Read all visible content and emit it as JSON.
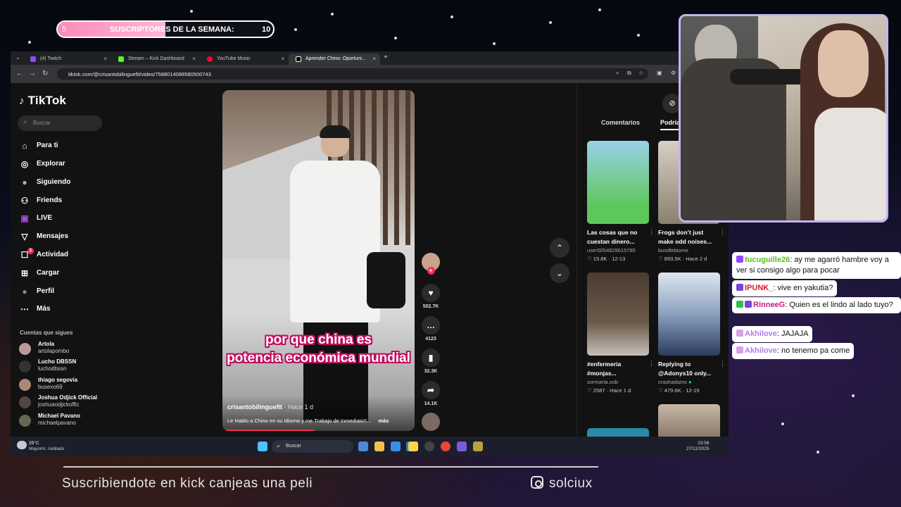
{
  "overlay": {
    "sub_goal": {
      "current": "5",
      "label": "SUSCRIPTORES DE LA SEMANA:",
      "goal": "10",
      "progress": 0.5
    },
    "promo_text": "Suscribiendote en kick canjeas una peli",
    "social_handle": "solciux"
  },
  "browser": {
    "tabs": [
      {
        "label": "(4) Twitch",
        "color": "#9146ff"
      },
      {
        "label": "Stream – Kick Dashboard",
        "color": "#53fc18"
      },
      {
        "label": "YouTube Music",
        "color": "#ff0033"
      },
      {
        "label": "Aprender Chino: Oportuni...",
        "color": "#ffffff"
      }
    ],
    "new_tab": "+",
    "url": "tiktok.com/@crisantobilinguefit/video/7588014088580500743"
  },
  "tiktok": {
    "logo": "TikTok",
    "search_placeholder": "Buscar",
    "nav": [
      {
        "label": "Para ti",
        "icon": "⌂"
      },
      {
        "label": "Explorar",
        "icon": "◎"
      },
      {
        "label": "Siguiendo",
        "icon": "●"
      },
      {
        "label": "Friends",
        "icon": "⚇"
      },
      {
        "label": "LIVE",
        "icon": "▣"
      },
      {
        "label": "Mensajes",
        "icon": "▽"
      },
      {
        "label": "Actividad",
        "icon": "☐"
      },
      {
        "label": "Cargar",
        "icon": "⊞"
      },
      {
        "label": "Perfil",
        "icon": "●"
      },
      {
        "label": "Más",
        "icon": "⋯"
      }
    ],
    "activity_badge": "1",
    "following_title": "Cuentas que sigues",
    "following": [
      {
        "name": "Artola",
        "handle": "artolapombo"
      },
      {
        "name": "Lucho DBSSN",
        "handle": "luchodbssn"
      },
      {
        "name": "thiago segovia",
        "handle": "busexo69"
      },
      {
        "name": "Joshua Odjick Official",
        "handle": "joshuaodjickoffic"
      },
      {
        "name": "Michael Pavano",
        "handle": "michaelpavano"
      }
    ],
    "video": {
      "caption_line1": "por que china es",
      "caption_line2": "potencia económica mundial",
      "author": "crisantobilinguefit",
      "time": "· Hace 1 d",
      "description": "Le Hablo a Chino en su Idioma y me Trabajo de Inmediato!!...",
      "more": "más",
      "likes": "502.7K",
      "comments": "4123",
      "saves": "32.3K",
      "shares": "14.1K"
    },
    "right_tabs": {
      "comments": "Comentarios",
      "maybe": "Podría"
    },
    "cards": [
      {
        "title": "Las cosas que no cuestan dinero...",
        "author": "user5054829615785",
        "stats": "♡ 15.8K · 12-13"
      },
      {
        "title": "Frogs don’t just make odd noises...",
        "author": "bundlebiome",
        "stats": "♡ 893.5K · Hace 2 d"
      },
      {
        "title": "#enfermeria #monjas...",
        "author": "sormarta.osb",
        "stats": "♡ 2587 · Hace 1 d"
      },
      {
        "title": "Replying to @Adonys10 only...",
        "author": "crashadams",
        "stats": "♡ 479.6K · 12-19"
      }
    ]
  },
  "taskbar": {
    "weather_temp": "25°C",
    "weather_desc": "Mayorm. nublado",
    "search": "Buscar",
    "time": "23:56",
    "date": "27/12/2025"
  },
  "chat": [
    {
      "user": "tucuguille26",
      "message": ": ay me agarró hambre voy a ver si consigo algo para pocar",
      "user_color": "#53c21a",
      "badge_color": "#9146ff"
    },
    {
      "user": "IPUNK_",
      "message": ": vive en yakutia?",
      "user_color": "#d81b2a",
      "badge_color": "#7a44d8"
    },
    {
      "user": "RinneeG",
      "message": ": Quien es el lindo al lado tuyo?",
      "user_color": "#c81b8a",
      "badge_color": "#2fbf4a"
    },
    {
      "user": "Akhilove",
      "message": ": JAJAJA",
      "user_color": "#b07ce8",
      "badge_color": "#d9a0e8"
    },
    {
      "user": "Akhilove",
      "message": ": no tenemo pa come",
      "user_color": "#b07ce8",
      "badge_color": "#d9a0e8"
    }
  ]
}
